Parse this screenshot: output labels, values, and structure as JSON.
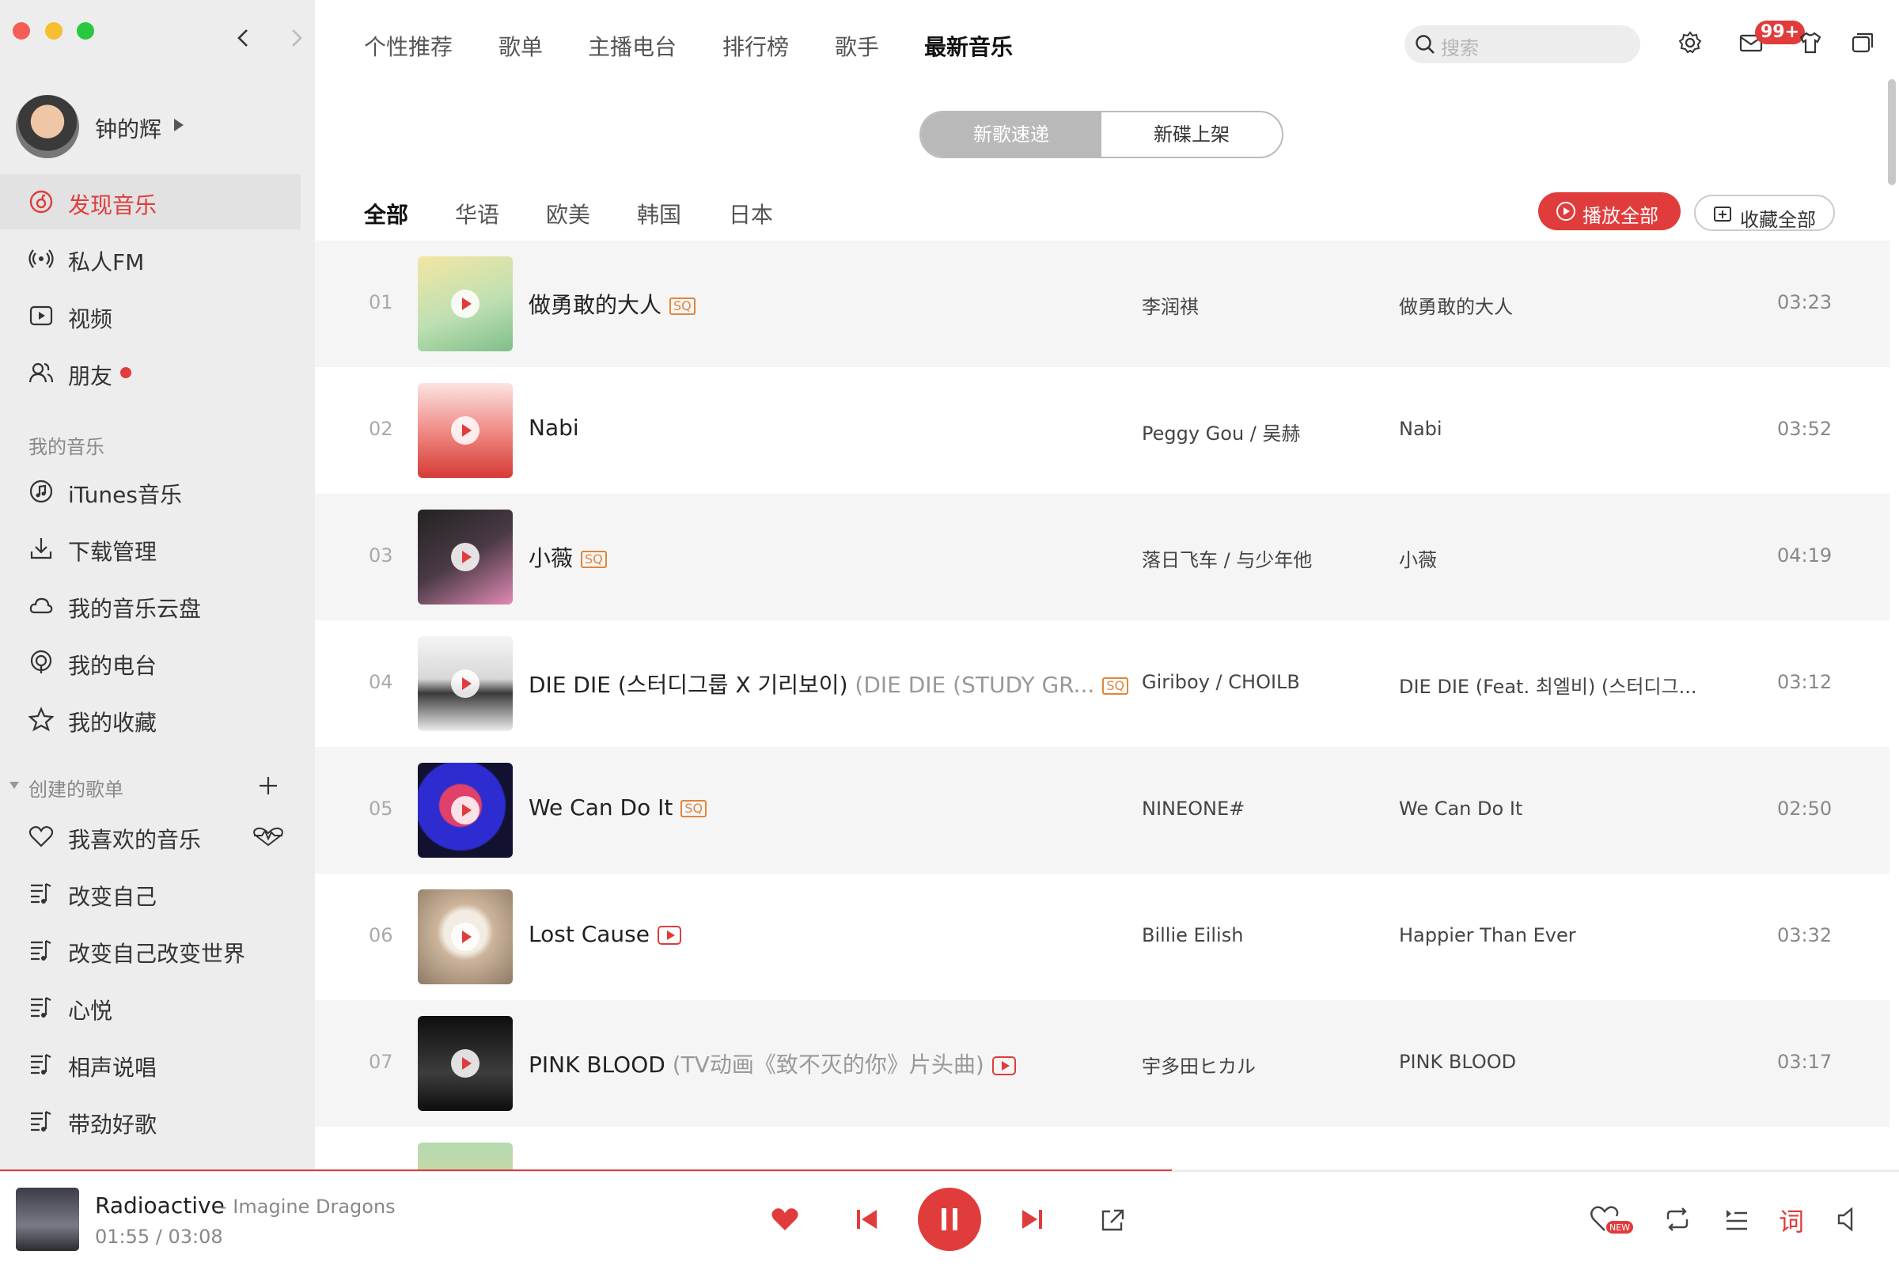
{
  "nav": {
    "tabs": [
      {
        "label": "个性推荐"
      },
      {
        "label": "歌单"
      },
      {
        "label": "主播电台"
      },
      {
        "label": "排行榜"
      },
      {
        "label": "歌手"
      },
      {
        "label": "最新音乐",
        "active": true
      }
    ],
    "search_placeholder": "搜索",
    "mail_badge": "99+"
  },
  "user": {
    "name": "钟的辉"
  },
  "sidebar": {
    "primary": [
      {
        "label": "发现音乐",
        "icon": "netease-logo-icon",
        "active": true
      },
      {
        "label": "私人FM",
        "icon": "radio-icon"
      },
      {
        "label": "视频",
        "icon": "video-icon"
      },
      {
        "label": "朋友",
        "icon": "friends-icon"
      }
    ],
    "my_music_header": "我的音乐",
    "my_music": [
      {
        "label": "iTunes音乐",
        "icon": "music-note-icon"
      },
      {
        "label": "下载管理",
        "icon": "download-icon"
      },
      {
        "label": "我的音乐云盘",
        "icon": "cloud-icon"
      },
      {
        "label": "我的电台",
        "icon": "podcast-icon"
      },
      {
        "label": "我的收藏",
        "icon": "star-icon"
      }
    ],
    "created_header": "创建的歌单",
    "playlists": [
      {
        "label": "我喜欢的音乐",
        "icon": "heart-icon"
      },
      {
        "label": "改变自己",
        "icon": "playlist-icon"
      },
      {
        "label": "改变自己改变世界",
        "icon": "playlist-icon"
      },
      {
        "label": "心悦",
        "icon": "playlist-icon"
      },
      {
        "label": "相声说唱",
        "icon": "playlist-icon"
      },
      {
        "label": "带劲好歌",
        "icon": "playlist-icon"
      }
    ]
  },
  "segment": {
    "new_songs": "新歌速递",
    "new_albums": "新碟上架"
  },
  "filters": [
    {
      "label": "全部",
      "active": true
    },
    {
      "label": "华语"
    },
    {
      "label": "欧美"
    },
    {
      "label": "韩国"
    },
    {
      "label": "日本"
    }
  ],
  "actions": {
    "play_all": "播放全部",
    "collect_all": "收藏全部"
  },
  "songs": [
    {
      "num": "01",
      "title": "做勇敢的大人",
      "subtitle": "",
      "tag": "SQ",
      "artist": "李润祺",
      "album": "做勇敢的大人",
      "duration": "03:23",
      "cover_color": "#cfe3b9"
    },
    {
      "num": "02",
      "title": "Nabi",
      "subtitle": "",
      "tag": "",
      "artist": "Peggy Gou / 吴赫",
      "album": "Nabi",
      "duration": "03:52",
      "cover_color": "#e8574f"
    },
    {
      "num": "03",
      "title": "小薇",
      "subtitle": "",
      "tag": "SQ",
      "artist": "落日飞车 / 与少年他",
      "album": "小薇",
      "duration": "04:19",
      "cover_color": "#2b2a33"
    },
    {
      "num": "04",
      "title": "DIE DIE (스터디그룹 X 기리보이)",
      "subtitle": "(DIE DIE (STUDY GR...",
      "tag": "SQ",
      "artist": "Giriboy / CHOILB",
      "album": "DIE DIE (Feat. 최엘비) (스터디그...",
      "duration": "03:12",
      "cover_color": "#e9e9e9"
    },
    {
      "num": "05",
      "title": "We Can Do It",
      "subtitle": "",
      "tag": "SQ",
      "artist": "NINEONE#",
      "album": "We Can Do It",
      "duration": "02:50",
      "cover_color": "#3b3bd6"
    },
    {
      "num": "06",
      "title": "Lost Cause",
      "subtitle": "",
      "tag": "MV",
      "artist": "Billie Eilish",
      "album": "Happier Than Ever",
      "duration": "03:32",
      "cover_color": "#c9b49e"
    },
    {
      "num": "07",
      "title": "PINK BLOOD",
      "subtitle": "(TV动画《致不灭的你》片头曲)",
      "tag": "MV",
      "artist": "宇多田ヒカル",
      "album": "PINK BLOOD",
      "duration": "03:17",
      "cover_color": "#111111"
    }
  ],
  "player": {
    "title": "Radioactive",
    "artist": "Imagine Dragons",
    "artist_sep": "- ",
    "time": "01:55 /  03:08",
    "progress": 0.617,
    "lyrics_label": "词",
    "heart_new_label": "NEW"
  },
  "colors": {
    "accent": "#e03c3c",
    "sidebar_bg": "#ededed"
  }
}
